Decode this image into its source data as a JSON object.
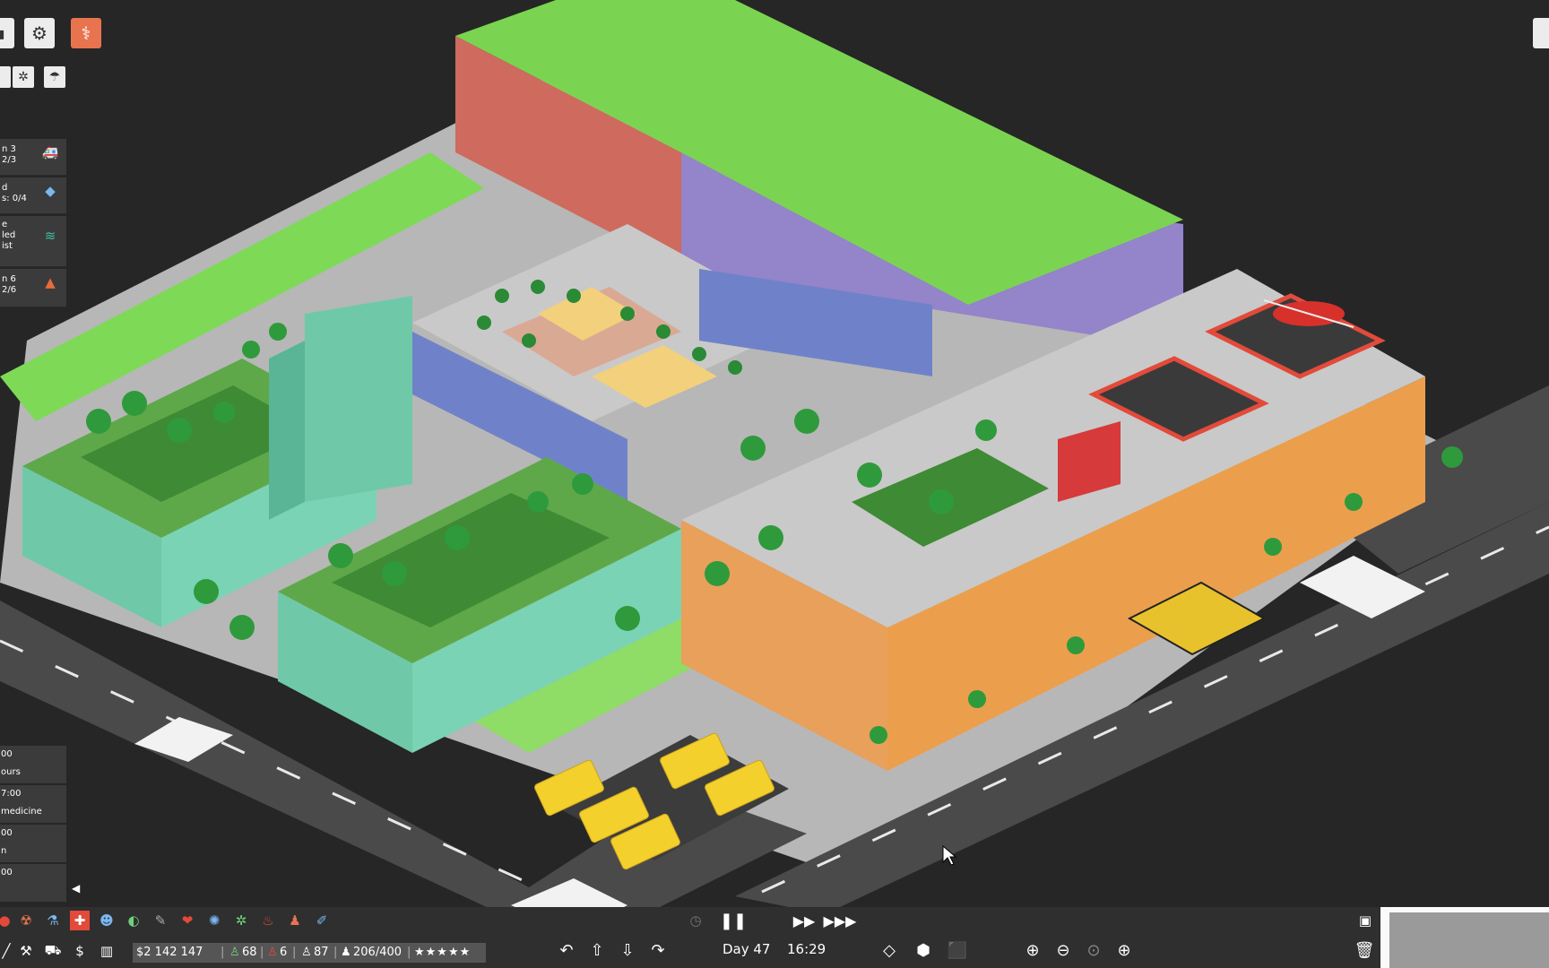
{
  "goals": [
    {
      "line1": "n 3",
      "line2": "2/3",
      "icon": "ambulance-icon"
    },
    {
      "line1": "d",
      "line2": "s: 0/4",
      "icon": "diamond-icon"
    },
    {
      "line1": "e",
      "line2": "led",
      "line3": "ist",
      "icon": "wave-icon"
    },
    {
      "line1": "n 6",
      "line2": "2/6",
      "icon": "mountain-icon"
    }
  ],
  "notes": [
    {
      "a": "00",
      "b": "ours"
    },
    {
      "a": "7:00",
      "b": "medicine"
    },
    {
      "a": "00",
      "b": "n"
    },
    {
      "a": "00",
      "b": ""
    }
  ],
  "stats": {
    "money": "$2 142 147",
    "staff_green": "68",
    "staff_red": "6",
    "visitors": "87",
    "patients": "206/400",
    "rating": "★★★★★"
  },
  "time": {
    "day": "Day 47",
    "clock": "16:29"
  },
  "colors": {
    "bar_bg": "#2f2f2f",
    "stat_bg": "#555555",
    "grass": "#7ed957",
    "road": "#4a4a4a"
  }
}
